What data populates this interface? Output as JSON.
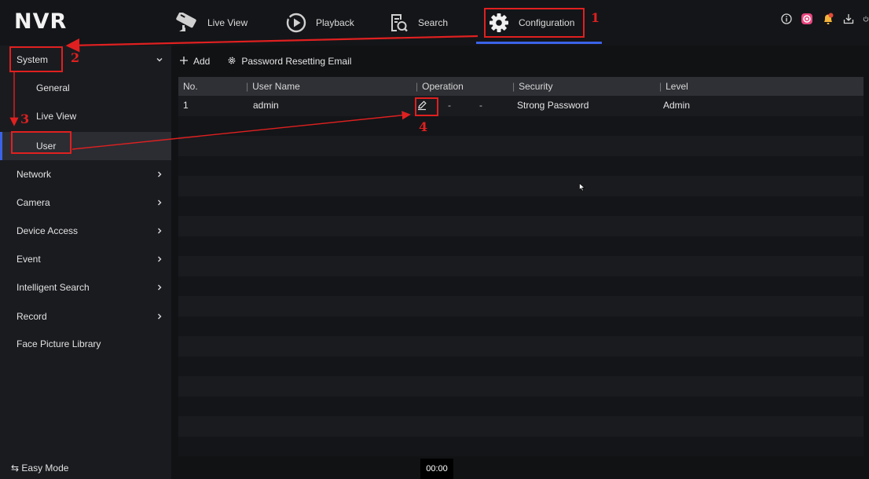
{
  "app": {
    "logo": "NVR"
  },
  "nav": {
    "live_view": "Live View",
    "playback": "Playback",
    "search": "Search",
    "configuration": "Configuration"
  },
  "sidebar": {
    "items": [
      {
        "label": "System"
      },
      {
        "label": "General"
      },
      {
        "label": "Live View"
      },
      {
        "label": "User"
      },
      {
        "label": "Network"
      },
      {
        "label": "Camera"
      },
      {
        "label": "Device Access"
      },
      {
        "label": "Event"
      },
      {
        "label": "Intelligent Search"
      },
      {
        "label": "Record"
      },
      {
        "label": "Face Picture Library"
      }
    ],
    "easy_mode": "⇆ Easy Mode"
  },
  "toolbar": {
    "add_label": "Add",
    "password_email_label": "Password Resetting Email"
  },
  "table": {
    "headers": {
      "no": "No.",
      "user_name": "User Name",
      "operation": "Operation",
      "security": "Security",
      "level": "Level"
    },
    "rows": [
      {
        "no": "1",
        "user_name": "admin",
        "dash1": "-",
        "dash2": "-",
        "security": "Strong Password",
        "level": "Admin"
      }
    ]
  },
  "time": "00:00",
  "annotations": {
    "n1": "1",
    "n2": "2",
    "n3": "3",
    "n4": "4"
  },
  "colors": {
    "accent": "#3b62e8",
    "annotation": "#e02020",
    "badge": "#e04b3a"
  }
}
